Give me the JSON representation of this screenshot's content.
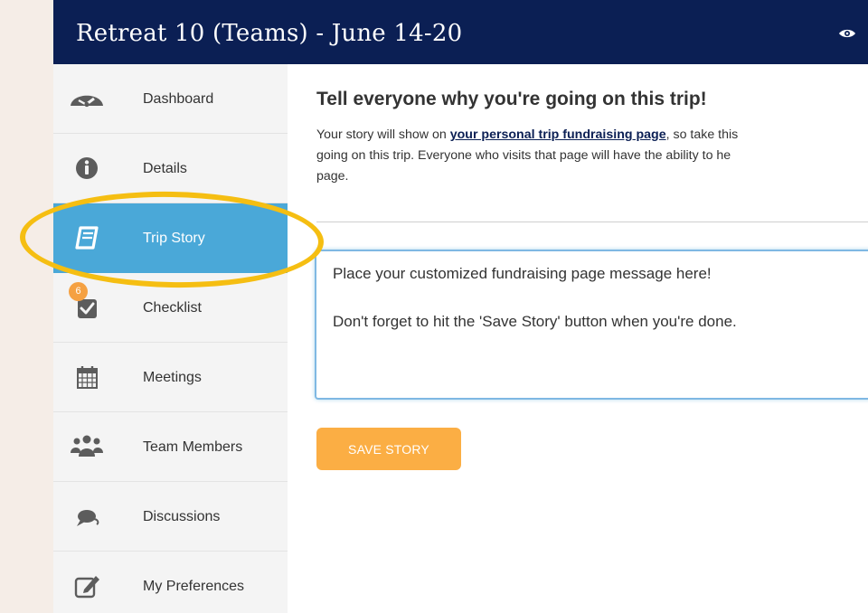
{
  "header": {
    "title": "Retreat 10 (Teams) - June 14-20",
    "right_icon": "eye-icon"
  },
  "sidebar": {
    "items": [
      {
        "label": "Dashboard",
        "icon": "speedometer-icon",
        "active": false
      },
      {
        "label": "Details",
        "icon": "info-icon",
        "active": false
      },
      {
        "label": "Trip Story",
        "icon": "book-icon",
        "active": true
      },
      {
        "label": "Checklist",
        "icon": "checkbox-icon",
        "active": false,
        "badge": "6"
      },
      {
        "label": "Meetings",
        "icon": "calendar-icon",
        "active": false
      },
      {
        "label": "Team Members",
        "icon": "group-icon",
        "active": false
      },
      {
        "label": "Discussions",
        "icon": "chat-bubbles-icon",
        "active": false
      },
      {
        "label": "My Preferences",
        "icon": "edit-icon",
        "active": false
      }
    ]
  },
  "main": {
    "heading": "Tell everyone why you're going on this trip!",
    "intro": {
      "line1_before": "Your story will show on ",
      "link_text": "your personal trip fundraising page",
      "line1_after": ", so take this",
      "line2": "going on this trip. Everyone who visits that page will have the ability to he",
      "line3": "page."
    },
    "story": {
      "line1": "Place your customized fundraising page message here!",
      "line2": "Don't forget to hit the 'Save Story' button when you're done."
    },
    "save_button_label": "SAVE STORY"
  },
  "colors": {
    "header_bg": "#0b1f54",
    "active_nav": "#4aa8d8",
    "save_button": "#fbae44",
    "badge": "#f5a142",
    "highlight_ring": "#f5be12",
    "page_bg": "#f5ede7"
  }
}
